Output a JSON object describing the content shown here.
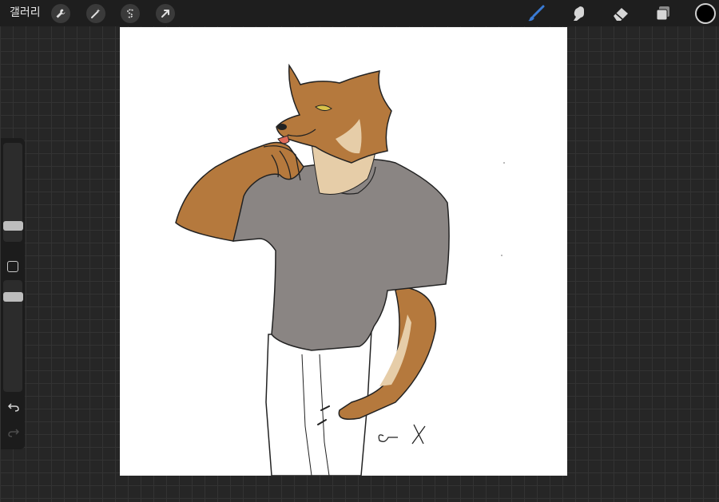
{
  "topbar": {
    "gallery_label": "갤러리",
    "left_tools": [
      {
        "name": "actions",
        "icon": "wrench-icon"
      },
      {
        "name": "adjustments",
        "icon": "magic-wand-icon"
      },
      {
        "name": "selection",
        "icon": "selection-s-icon"
      },
      {
        "name": "transform",
        "icon": "arrow-cursor-icon"
      }
    ],
    "right_tools": [
      {
        "name": "brush",
        "icon": "brush-icon",
        "active": true
      },
      {
        "name": "smudge",
        "icon": "smudge-finger-icon"
      },
      {
        "name": "eraser",
        "icon": "eraser-icon"
      },
      {
        "name": "layers",
        "icon": "layers-icon"
      }
    ],
    "current_color": "#000000",
    "active_color": "#3a7bd5"
  },
  "sidebar": {
    "brush_size_level": 0.25,
    "opacity_level": 0.9,
    "undo_icon": "undo-arrow-icon",
    "redo_icon": "redo-arrow-icon"
  },
  "canvas": {
    "background": "#ffffff",
    "fur_color": "#b5793d",
    "light_fur_color": "#e6cda8",
    "shirt_color": "#8a8583",
    "tongue_color": "#e06a5a",
    "eye_color": "#d9c24a"
  }
}
